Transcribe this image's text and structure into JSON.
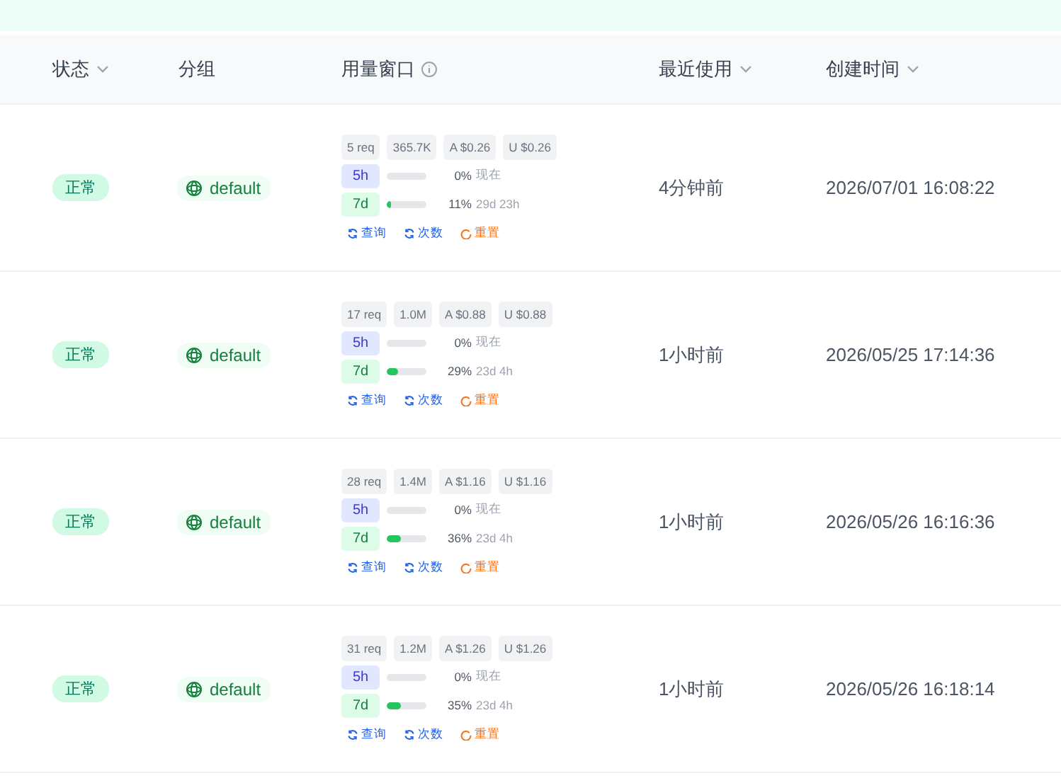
{
  "columns": [
    {
      "label": "状态",
      "sortable": true
    },
    {
      "label": "分组",
      "sortable": false
    },
    {
      "label": "用量窗口",
      "info": true
    },
    {
      "label": "最近使用",
      "sortable": true
    },
    {
      "label": "创建时间",
      "sortable": true
    }
  ],
  "rows": [
    {
      "status": "正常",
      "group": "default",
      "chips": [
        "5 req",
        "365.7K",
        "A $0.26",
        "U $0.26"
      ],
      "windows": [
        {
          "kind": "short",
          "label": "5h",
          "level": 0,
          "percent": "0%",
          "reset": "现在"
        },
        {
          "kind": "weekly",
          "label": "7d",
          "level": 0.11,
          "percent": "11%",
          "reset": "29d 23h"
        }
      ],
      "actions": [
        {
          "kind": "query",
          "label": "查询"
        },
        {
          "kind": "count",
          "label": "次数"
        },
        {
          "kind": "reset",
          "label": "重置"
        }
      ],
      "last_used": "4分钟前",
      "created": "2026/07/01 16:08:22"
    },
    {
      "status": "正常",
      "group": "default",
      "chips": [
        "17 req",
        "1.0M",
        "A $0.88",
        "U $0.88"
      ],
      "windows": [
        {
          "kind": "short",
          "label": "5h",
          "level": 0,
          "percent": "0%",
          "reset": "现在"
        },
        {
          "kind": "weekly",
          "label": "7d",
          "level": 0.29,
          "percent": "29%",
          "reset": "23d 4h"
        }
      ],
      "actions": [
        {
          "kind": "query",
          "label": "查询"
        },
        {
          "kind": "count",
          "label": "次数"
        },
        {
          "kind": "reset",
          "label": "重置"
        }
      ],
      "last_used": "1小时前",
      "created": "2026/05/25 17:14:36"
    },
    {
      "status": "正常",
      "group": "default",
      "chips": [
        "28 req",
        "1.4M",
        "A $1.16",
        "U $1.16"
      ],
      "windows": [
        {
          "kind": "short",
          "label": "5h",
          "level": 0,
          "percent": "0%",
          "reset": "现在"
        },
        {
          "kind": "weekly",
          "label": "7d",
          "level": 0.36,
          "percent": "36%",
          "reset": "23d 4h"
        }
      ],
      "actions": [
        {
          "kind": "query",
          "label": "查询"
        },
        {
          "kind": "count",
          "label": "次数"
        },
        {
          "kind": "reset",
          "label": "重置"
        }
      ],
      "last_used": "1小时前",
      "created": "2026/05/26 16:16:36"
    },
    {
      "status": "正常",
      "group": "default",
      "chips": [
        "31 req",
        "1.2M",
        "A $1.26",
        "U $1.26"
      ],
      "windows": [
        {
          "kind": "short",
          "label": "5h",
          "level": 0,
          "percent": "0%",
          "reset": "现在"
        },
        {
          "kind": "weekly",
          "label": "7d",
          "level": 0.35,
          "percent": "35%",
          "reset": "23d 4h"
        }
      ],
      "actions": [
        {
          "kind": "query",
          "label": "查询"
        },
        {
          "kind": "count",
          "label": "次数"
        },
        {
          "kind": "reset",
          "label": "重置"
        }
      ],
      "last_used": "1小时前",
      "created": "2026/05/26 16:18:14"
    }
  ]
}
